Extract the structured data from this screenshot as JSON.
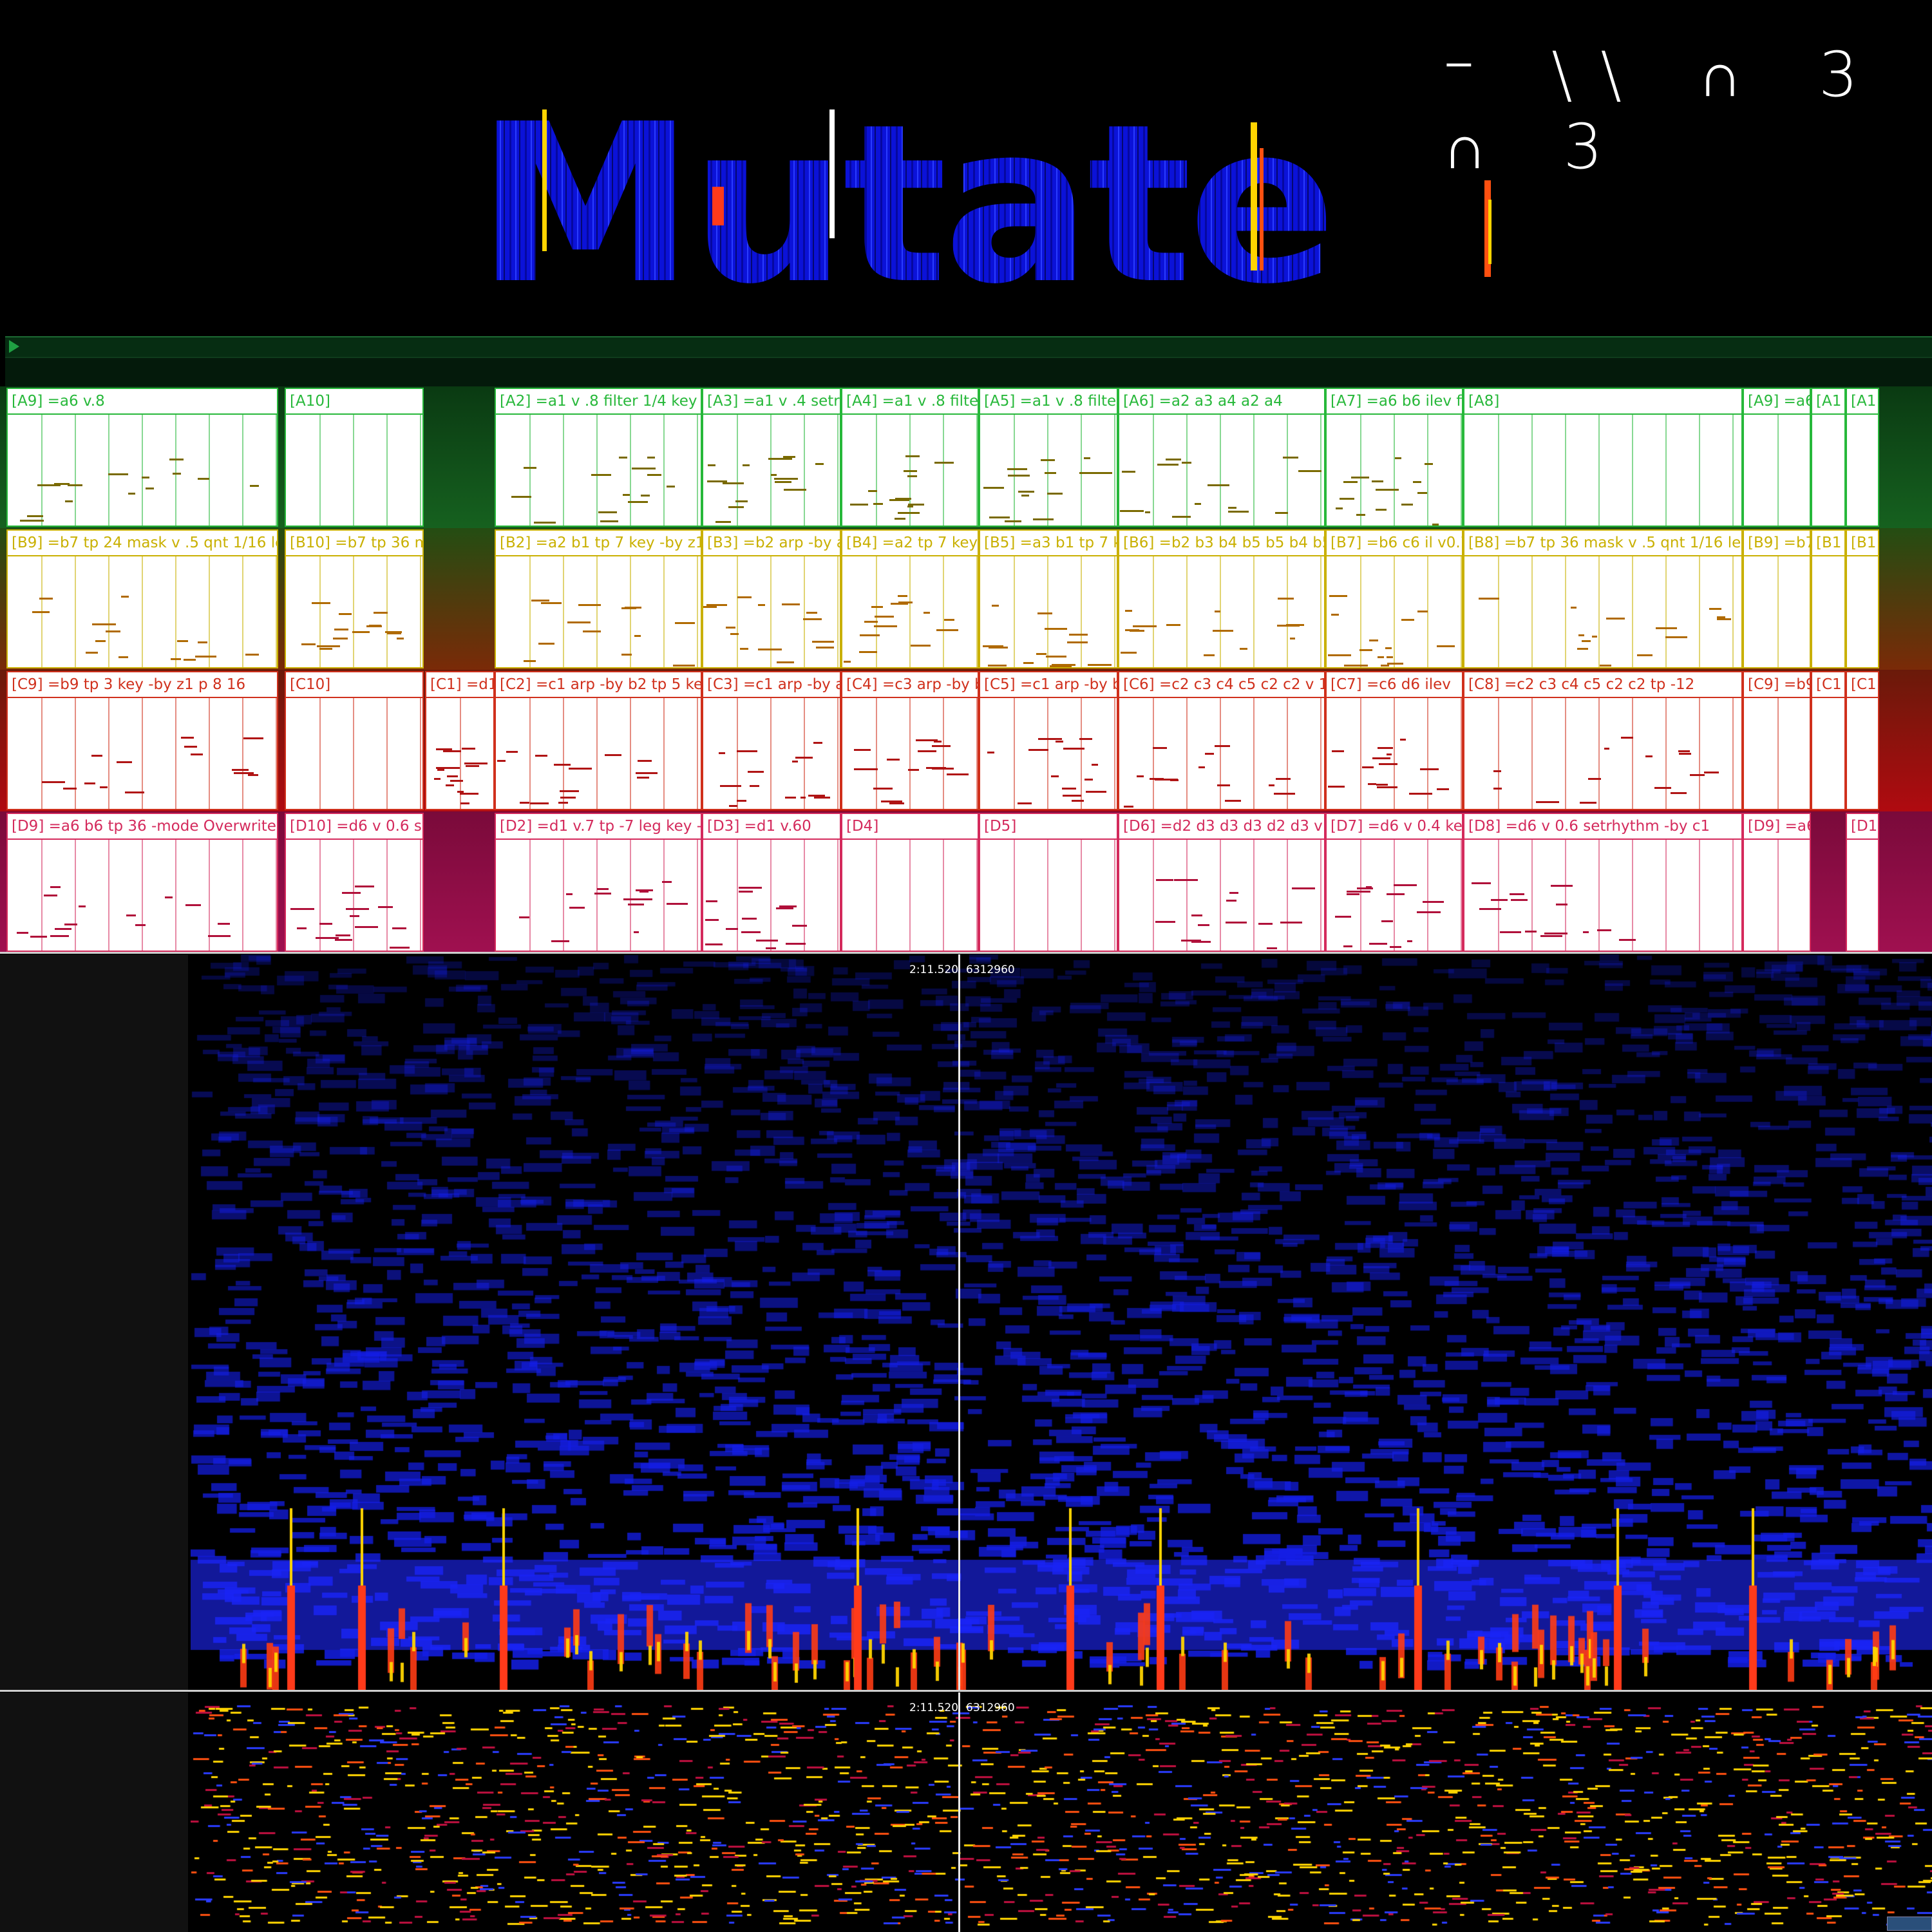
{
  "header": {
    "glyph_title": "⁻ \\\\ ∩ 3 ∩ 3",
    "logo_text": "Mutate"
  },
  "colors": {
    "lane_a": "#27b83a",
    "lane_b": "#c9b000",
    "lane_c": "#d0301c",
    "lane_d": "#d42a5c",
    "note_a": "#7a6a00",
    "note_b": "#b06a00",
    "note_c": "#b01414",
    "note_d": "#b0103a",
    "spectrum_low": "#0a10d0",
    "spectrum_high": "#ffd400"
  },
  "lanes": [
    {
      "id": "A",
      "clips": [
        {
          "label": "[A9] =a6 v.8"
        },
        {
          "label": "[A10]"
        },
        {
          "label": "[A2] =a1 v .8 filter 1/4 key"
        },
        {
          "label": "[A3] =a1 v  .4 setr"
        },
        {
          "label": "[A4] =a1 v .8 filte"
        },
        {
          "label": "[A5] =a1 v .8 filter"
        },
        {
          "label": "[A6]  =a2 a3 a4 a2 a4"
        },
        {
          "label": "[A7] =a6 b6 ilev fi"
        },
        {
          "label": "[A8]"
        },
        {
          "label": "[A9] =a6"
        },
        {
          "label": "[A1"
        },
        {
          "label": "[A1"
        }
      ]
    },
    {
      "id": "B",
      "clips": [
        {
          "label": "[B9] =b7 tp  24 mask v .5 qnt 1/16 le"
        },
        {
          "label": "[B10] =b7 tp 36 m"
        },
        {
          "label": "[B2] =a2 b1 tp 7 key -by z1"
        },
        {
          "label": "[B3] =b2 arp -by a"
        },
        {
          "label": "[B4] =a2 tp 7 key"
        },
        {
          "label": "[B5] =a3 b1 tp 7 k"
        },
        {
          "label": "[B6] =b2 b3 b4 b5 b5 b4 b5"
        },
        {
          "label": "[B7] =b6 c6 il v0.7"
        },
        {
          "label": "[B8] =b7 tp 36 mask v .5 qnt 1/16 le"
        },
        {
          "label": "[B9] =b7"
        },
        {
          "label": "[B1"
        },
        {
          "label": "[B1"
        }
      ]
    },
    {
      "id": "C",
      "clips": [
        {
          "label": "[C9] =b9 tp 3 key -by z1 p 8 16"
        },
        {
          "label": "[C10]"
        },
        {
          "label": "[C1]  =d1"
        },
        {
          "label": "[C2] =c1 arp -by b2 tp 5 ke"
        },
        {
          "label": "[C3] =c1 arp -by a"
        },
        {
          "label": "[C4] =c3 arp -by b"
        },
        {
          "label": "[C5] =c1 arp -by b"
        },
        {
          "label": "[C6]  =c2 c3 c4 c5 c2 c2 v 1"
        },
        {
          "label": "[C7] =c6 d6 ilev"
        },
        {
          "label": "[C8]  =c2 c3 c4 c5 c2 c2 tp -12"
        },
        {
          "label": "[C9] =b9"
        },
        {
          "label": "[C1"
        },
        {
          "label": "[C1"
        }
      ]
    },
    {
      "id": "D",
      "clips": [
        {
          "label": "[D9] =a6 b6 tp 36 -mode Overwrite"
        },
        {
          "label": "[D10] =d6 v 0.6 se"
        },
        {
          "label": "[D2] =d1 v.7 tp -7 leg key -"
        },
        {
          "label": "[D3] =d1 v.60"
        },
        {
          "label": "[D4]"
        },
        {
          "label": "[D5]"
        },
        {
          "label": "[D6] =d2 d3 d3 d3 d2 d3 v"
        },
        {
          "label": "[D7] =d6 v 0.4 key"
        },
        {
          "label": "[D8] =d6 v 0.6 setrhythm -by c1"
        },
        {
          "label": "[D9] =a6"
        },
        {
          "label": "[D1"
        }
      ]
    }
  ],
  "spectrogram": {
    "time_readout": "2:11.520",
    "sample_readout": "6312960"
  },
  "piano_roll": {
    "time_readout": "2:11.520",
    "sample_readout": "6312960"
  }
}
